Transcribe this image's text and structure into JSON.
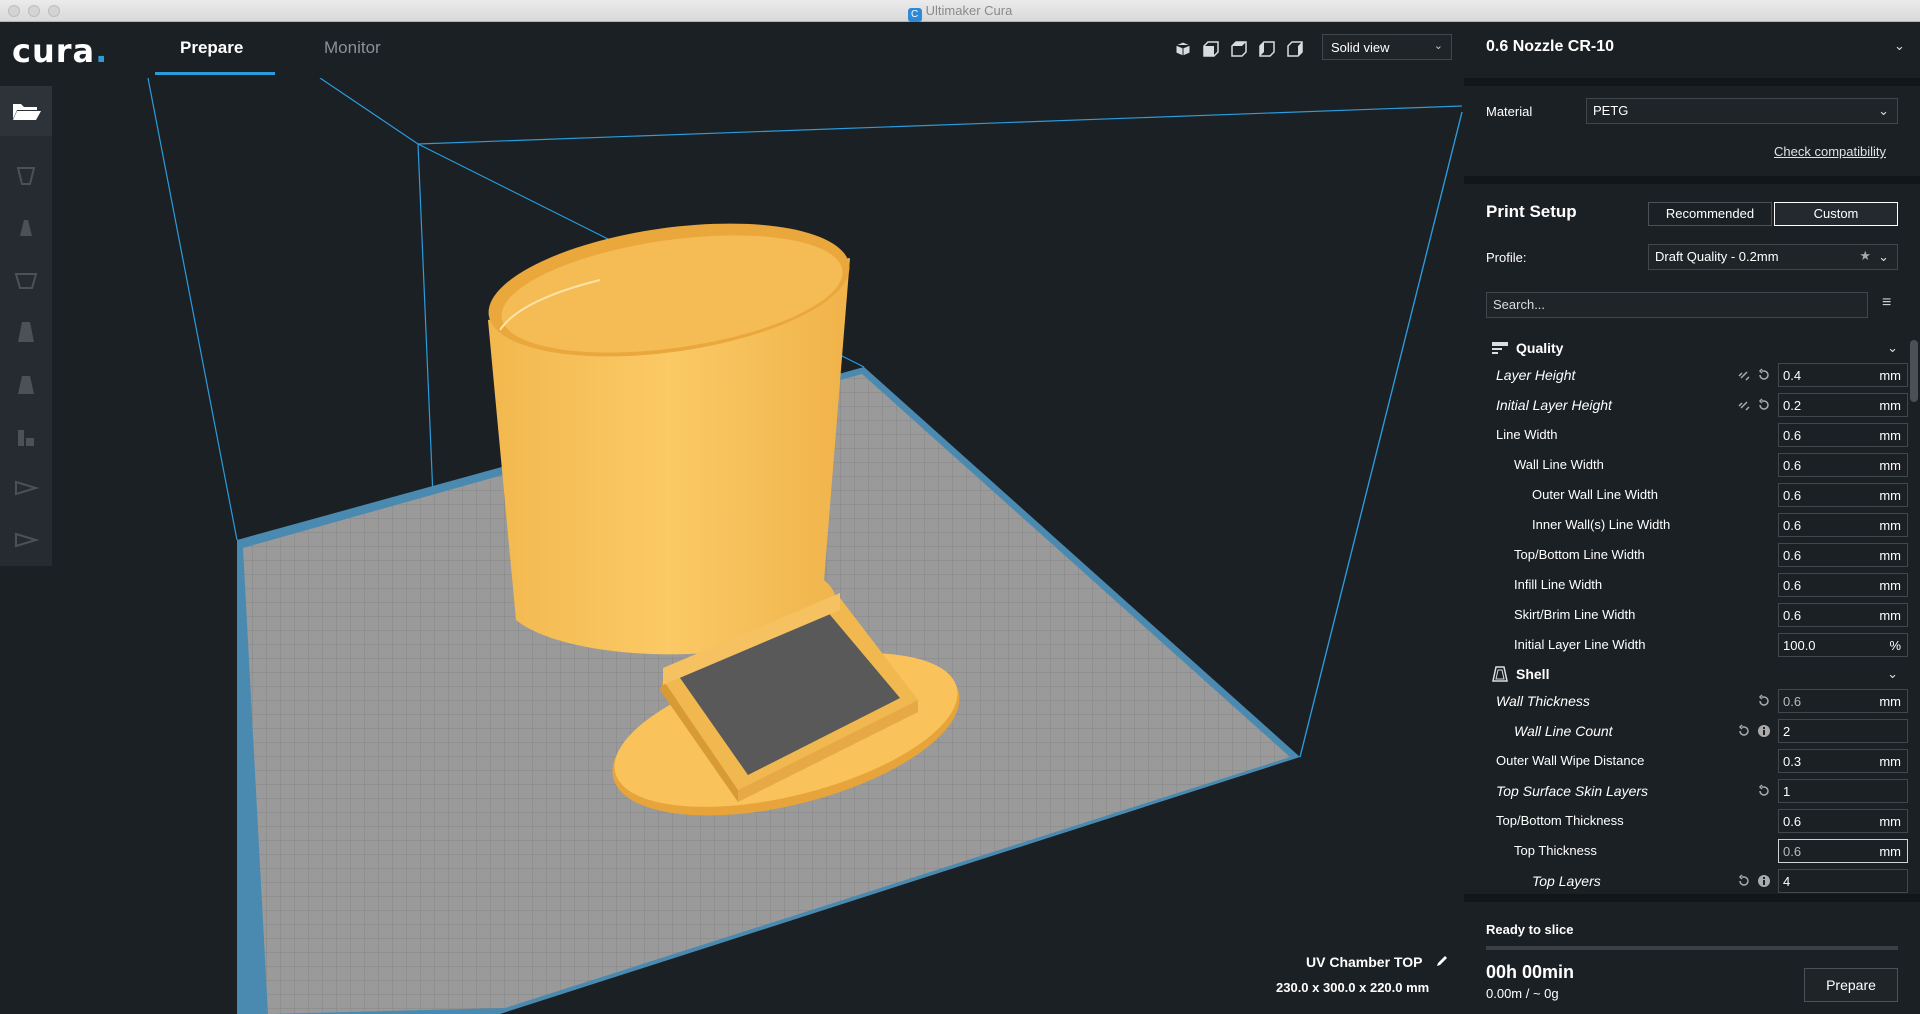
{
  "window": {
    "title": "Ultimaker Cura"
  },
  "header": {
    "logo_text": "cura",
    "logo_dot": ".",
    "tabs": [
      {
        "label": "Prepare",
        "active": true
      },
      {
        "label": "Monitor",
        "active": false
      }
    ],
    "view_icons": [
      "3d-view-icon",
      "front-view-icon",
      "top-view-icon",
      "left-view-icon",
      "right-view-icon"
    ],
    "view_mode": "Solid view"
  },
  "toolbar": {
    "tools": [
      "open-file-icon",
      "move-tool-icon",
      "scale-tool-icon",
      "rotate-tool-icon",
      "mirror-tool-icon",
      "per-model-settings-icon",
      "support-blocker-icon",
      "layer-view-icon",
      "play-icon"
    ]
  },
  "viewport": {
    "model_name": "UV Chamber TOP",
    "model_dimensions": "230.0 x 300.0 x 220.0 mm"
  },
  "panel": {
    "printer": "0.6 Nozzle CR-10",
    "material_label": "Material",
    "material_value": "PETG",
    "check_compat": "Check compatibility",
    "print_setup": "Print Setup",
    "mode_recommended": "Recommended",
    "mode_custom": "Custom",
    "profile_label": "Profile:",
    "profile_value": "Draft Quality - 0.2mm",
    "search_placeholder": "Search...",
    "categories": {
      "quality": "Quality",
      "shell": "Shell"
    },
    "settings": [
      {
        "name": "Layer Height",
        "value": "0.4",
        "unit": "mm"
      },
      {
        "name": "Initial Layer Height",
        "value": "0.2",
        "unit": "mm"
      },
      {
        "name": "Line Width",
        "value": "0.6",
        "unit": "mm"
      },
      {
        "name": "Wall Line Width",
        "value": "0.6",
        "unit": "mm"
      },
      {
        "name": "Outer Wall Line Width",
        "value": "0.6",
        "unit": "mm"
      },
      {
        "name": "Inner Wall(s) Line Width",
        "value": "0.6",
        "unit": "mm"
      },
      {
        "name": "Top/Bottom Line Width",
        "value": "0.6",
        "unit": "mm"
      },
      {
        "name": "Infill Line Width",
        "value": "0.6",
        "unit": "mm"
      },
      {
        "name": "Skirt/Brim Line Width",
        "value": "0.6",
        "unit": "mm"
      },
      {
        "name": "Initial Layer Line Width",
        "value": "100.0",
        "unit": "%"
      },
      {
        "name": "Wall Thickness",
        "value": "0.6",
        "unit": "mm"
      },
      {
        "name": "Wall Line Count",
        "value": "2",
        "unit": ""
      },
      {
        "name": "Outer Wall Wipe Distance",
        "value": "0.3",
        "unit": "mm"
      },
      {
        "name": "Top Surface Skin Layers",
        "value": "1",
        "unit": ""
      },
      {
        "name": "Top/Bottom Thickness",
        "value": "0.6",
        "unit": "mm"
      },
      {
        "name": "Top Thickness",
        "value": "0.6",
        "unit": "mm"
      },
      {
        "name": "Top Layers",
        "value": "4",
        "unit": ""
      }
    ],
    "slice": {
      "status": "Ready to slice",
      "time": "00h 00min",
      "amount": "0.00m / ~ 0g",
      "button": "Prepare"
    }
  },
  "colors": {
    "accent": "#2b9bdc",
    "model": "#f9c25b",
    "background": "#1b2024"
  }
}
